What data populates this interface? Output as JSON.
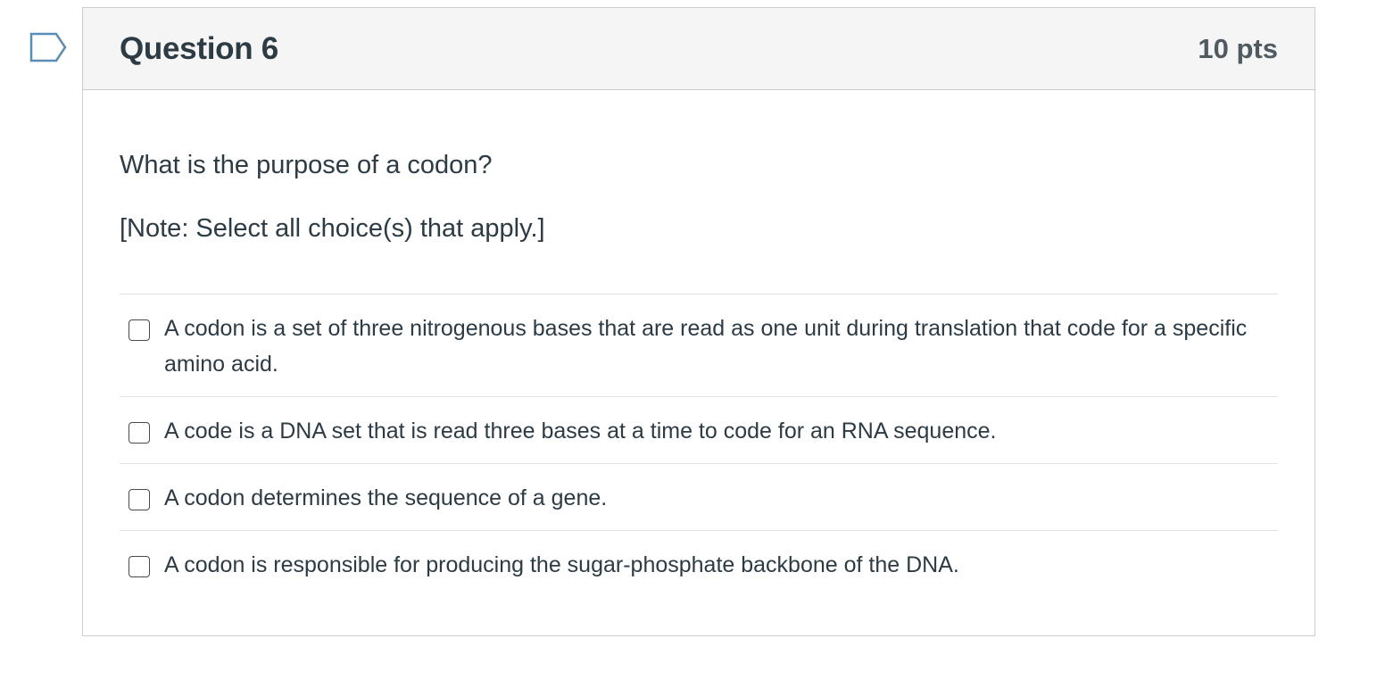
{
  "question": {
    "title": "Question 6",
    "points": "10 pts",
    "text": "What is the purpose of a codon?",
    "note": "[Note: Select all choice(s) that apply.]"
  },
  "answers": [
    {
      "label": "A codon is a set of three nitrogenous bases that are read as one unit during translation that code for a specific amino acid.",
      "checked": false
    },
    {
      "label": "A code is a DNA set that is read three bases at a time to code for an RNA sequence.",
      "checked": false
    },
    {
      "label": "A codon determines the sequence of a gene.",
      "checked": false
    },
    {
      "label": "A codon is responsible for producing the sugar-phosphate backbone of the DNA.",
      "checked": false
    }
  ],
  "colors": {
    "flag_border": "#2d6b9a",
    "header_bg": "#f5f5f5",
    "border": "#c7cdd1",
    "text": "#2d3b45"
  },
  "icons": {
    "flag": "bookmark-flag-icon"
  }
}
